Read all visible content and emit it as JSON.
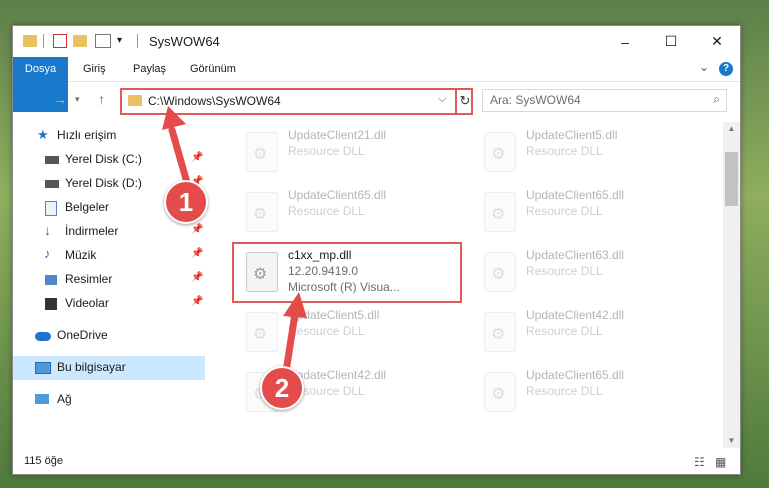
{
  "window": {
    "title": "SysWOW64",
    "minimize": "–",
    "maximize": "☐",
    "close": "✕"
  },
  "ribbon": {
    "tabs": [
      "Dosya",
      "Giriş",
      "Paylaş",
      "Görünüm"
    ],
    "help_icon": "?",
    "expand_icon": "⌄"
  },
  "address": {
    "path": "C:\\Windows\\SysWOW64",
    "search_placeholder": "Ara: SysWOW64"
  },
  "sidebar": {
    "items": [
      {
        "label": "Hızlı erişim",
        "icon": "star-icon"
      },
      {
        "label": "Yerel Disk (C:)",
        "icon": "drive-icon",
        "pinned": true
      },
      {
        "label": "Yerel Disk (D:)",
        "icon": "drive-icon",
        "pinned": true
      },
      {
        "label": "Belgeler",
        "icon": "documents-icon",
        "pinned": true
      },
      {
        "label": "İndirmeler",
        "icon": "download-icon",
        "pinned": true
      },
      {
        "label": "Müzik",
        "icon": "music-icon",
        "pinned": true
      },
      {
        "label": "Resimler",
        "icon": "pictures-icon",
        "pinned": true
      },
      {
        "label": "Videolar",
        "icon": "videos-icon",
        "pinned": true
      },
      {
        "label": "OneDrive",
        "icon": "cloud-icon"
      },
      {
        "label": "Bu bilgisayar",
        "icon": "computer-icon",
        "selected": true
      },
      {
        "label": "Ağ",
        "icon": "network-icon"
      }
    ]
  },
  "files": [
    {
      "name": "UpdateClient21.dll",
      "desc": "Resource DLL",
      "faded": true
    },
    {
      "name": "UpdateClient5.dll",
      "desc": "Resource DLL",
      "faded": true
    },
    {
      "name": "UpdateClient65.dll",
      "desc": "Resource DLL",
      "faded": true
    },
    {
      "name": "UpdateClient65.dll",
      "desc": "Resource DLL",
      "faded": true
    },
    {
      "name": "c1xx_mp.dll",
      "desc": "12.20.9419.0",
      "extra": "Microsoft (R) Visua...",
      "faded": false
    },
    {
      "name": "UpdateClient63.dll",
      "desc": "Resource DLL",
      "faded": true
    },
    {
      "name": "UpdateClient5.dll",
      "desc": "Resource DLL",
      "faded": true
    },
    {
      "name": "UpdateClient42.dll",
      "desc": "Resource DLL",
      "faded": true
    },
    {
      "name": "UpdateClient42.dll",
      "desc": "Resource DLL",
      "faded": true
    },
    {
      "name": "UpdateClient65.dll",
      "desc": "Resource DLL",
      "faded": true
    }
  ],
  "status": {
    "count": "115 öğe"
  },
  "annotations": {
    "step1": "1",
    "step2": "2",
    "color": "#e44b4b"
  }
}
